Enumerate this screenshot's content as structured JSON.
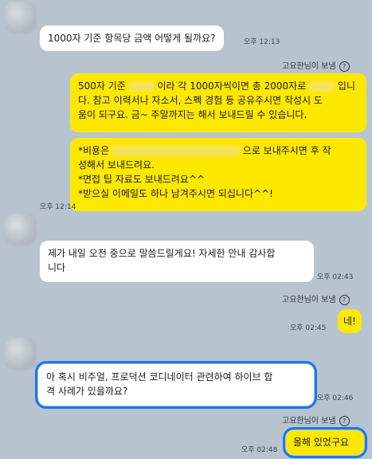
{
  "sender_label": "고요한님이 보냄",
  "help_glyph": "?",
  "messages": {
    "m1": {
      "text": "1000자 기준 항목당 금액 어떻게 될까요?",
      "time": "오후 12:13"
    },
    "m2": {
      "p1": "500자 기준",
      "p2": "이라 각 1000자씩이면 총 2000자로",
      "p3": "입니",
      "p4": "다. 참고 이력서나 자소서, 스펙 경험 등 공유주시면 작성시 도",
      "p5": "움이 되구요. 금~ 주말까지는 해서 보내드릴 수 있습니다."
    },
    "m3": {
      "p1": "*비용은",
      "p2": "으로 보내주시면 후 작",
      "p3": "성해서 보내드려요.",
      "p4": "*면접 팁 자료도 보내드려요^^",
      "p5": "*받으실 이메일도 하나 남겨주시면 되십니다^^!",
      "time": "오후 12:14"
    },
    "m4": {
      "p1": "제가 내일 오전 중으로 말씀드릴게요! 자세한 안내 감사합",
      "p2": "니다",
      "time": "오후 02:43"
    },
    "m5": {
      "text": "네!",
      "time": "오후 02:45"
    },
    "m6": {
      "p1": "아 혹시 비주얼, 프로덕션 코디네이터 관련하여 하이브 합",
      "p2": "격 사례가 있을까요?",
      "time": "오후 02:46"
    },
    "m7": {
      "text": "올해 있었구요",
      "time": "오후 02:48"
    }
  }
}
